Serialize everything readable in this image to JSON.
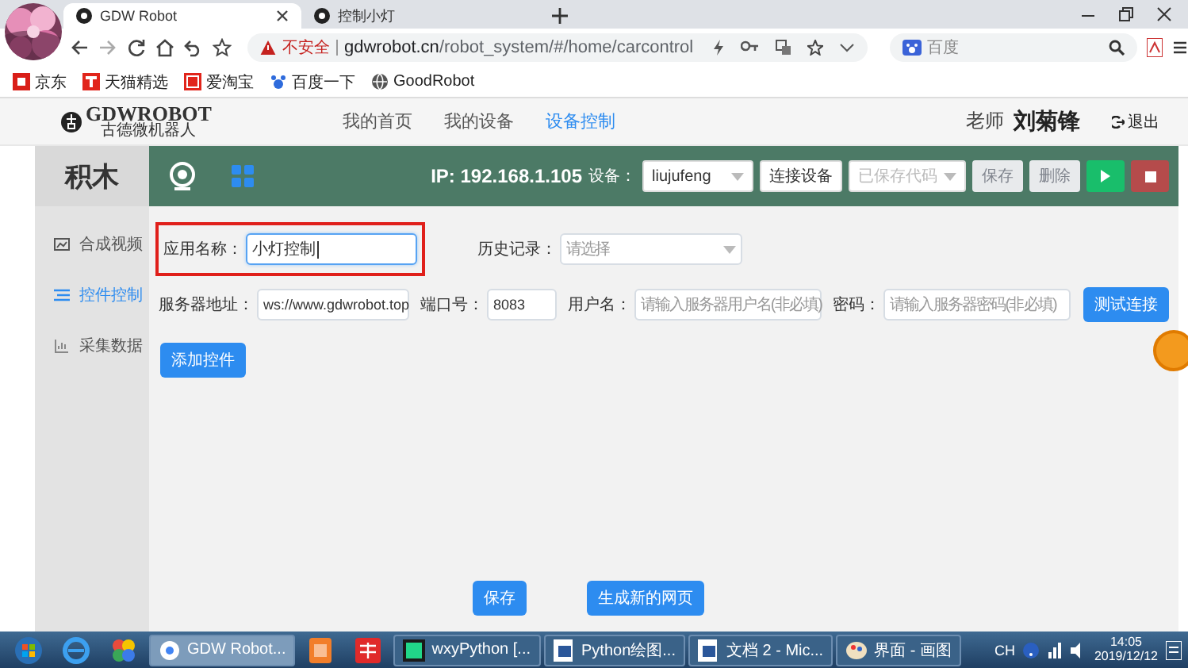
{
  "browser": {
    "tabs": [
      {
        "title": "GDW Robot",
        "selected": true
      },
      {
        "title": "控制小灯",
        "selected": false
      }
    ],
    "security_label": "不安全",
    "url_host": "gdwrobot.cn",
    "url_path": "/robot_system/#/home/carcontrol",
    "search": {
      "placeholder": "百度"
    },
    "bookmarks": [
      "京东",
      "天猫精选",
      "爱淘宝",
      "百度一下",
      "GoodRobot"
    ]
  },
  "header": {
    "logo_text": "GDWROBOT",
    "logo_subtitle": "古德微机器人",
    "nav": [
      {
        "label": "我的首页",
        "selected": false
      },
      {
        "label": "我的设备",
        "selected": false
      },
      {
        "label": "设备控制",
        "selected": true
      }
    ],
    "role": "老师",
    "user": "刘菊锋",
    "logout": "退出"
  },
  "toolbar": {
    "panel_title": "积木",
    "ip": "IP: 192.168.1.105",
    "device_label": "设备：",
    "device": "liujufeng",
    "connect": "连接设备",
    "saved_code": {
      "placeholder": "已保存代码"
    },
    "buttons": [
      {
        "label": "保存",
        "disabled": true
      },
      {
        "label": "删除",
        "disabled": true
      }
    ]
  },
  "sidebar": {
    "items": [
      {
        "label": "合成视频",
        "selected": false
      },
      {
        "label": "控件控制",
        "selected": true
      },
      {
        "label": "采集数据",
        "selected": false
      }
    ]
  },
  "form": {
    "rows": [
      [
        {
          "label": "应用名称：",
          "kind": "text",
          "value": "小灯控制",
          "highlighted": true
        },
        {
          "label": "历史记录：",
          "kind": "select",
          "placeholder": "请选择",
          "highlighted": false
        }
      ],
      [
        {
          "label": "服务器地址：",
          "kind": "text",
          "value": "ws://www.gdwrobot.top",
          "highlighted": false
        },
        {
          "label": "端口号：",
          "kind": "text",
          "value": "8083",
          "highlighted": false
        },
        {
          "label": "用户名：",
          "kind": "text",
          "placeholder": "请输入服务器用户名(非必填)",
          "highlighted": false
        },
        {
          "label": "密码：",
          "kind": "text",
          "placeholder": "请输入服务器密码(非必填)",
          "highlighted": false
        }
      ]
    ],
    "test_button": "测试连接",
    "add_button": "添加控件",
    "footer_buttons": [
      "保存",
      "生成新的网页"
    ]
  },
  "taskbar": {
    "items": [
      {
        "label": "GDW Robot...",
        "selected": true
      },
      {
        "label": "wxyPython [...",
        "selected": false
      },
      {
        "label": "Python绘图...",
        "selected": false
      },
      {
        "label": "文档 2 - Mic...",
        "selected": false
      },
      {
        "label": "界面 - 画图",
        "selected": false
      }
    ],
    "input_indicator": "CH",
    "time": "14:05",
    "date": "2019/12/12"
  }
}
